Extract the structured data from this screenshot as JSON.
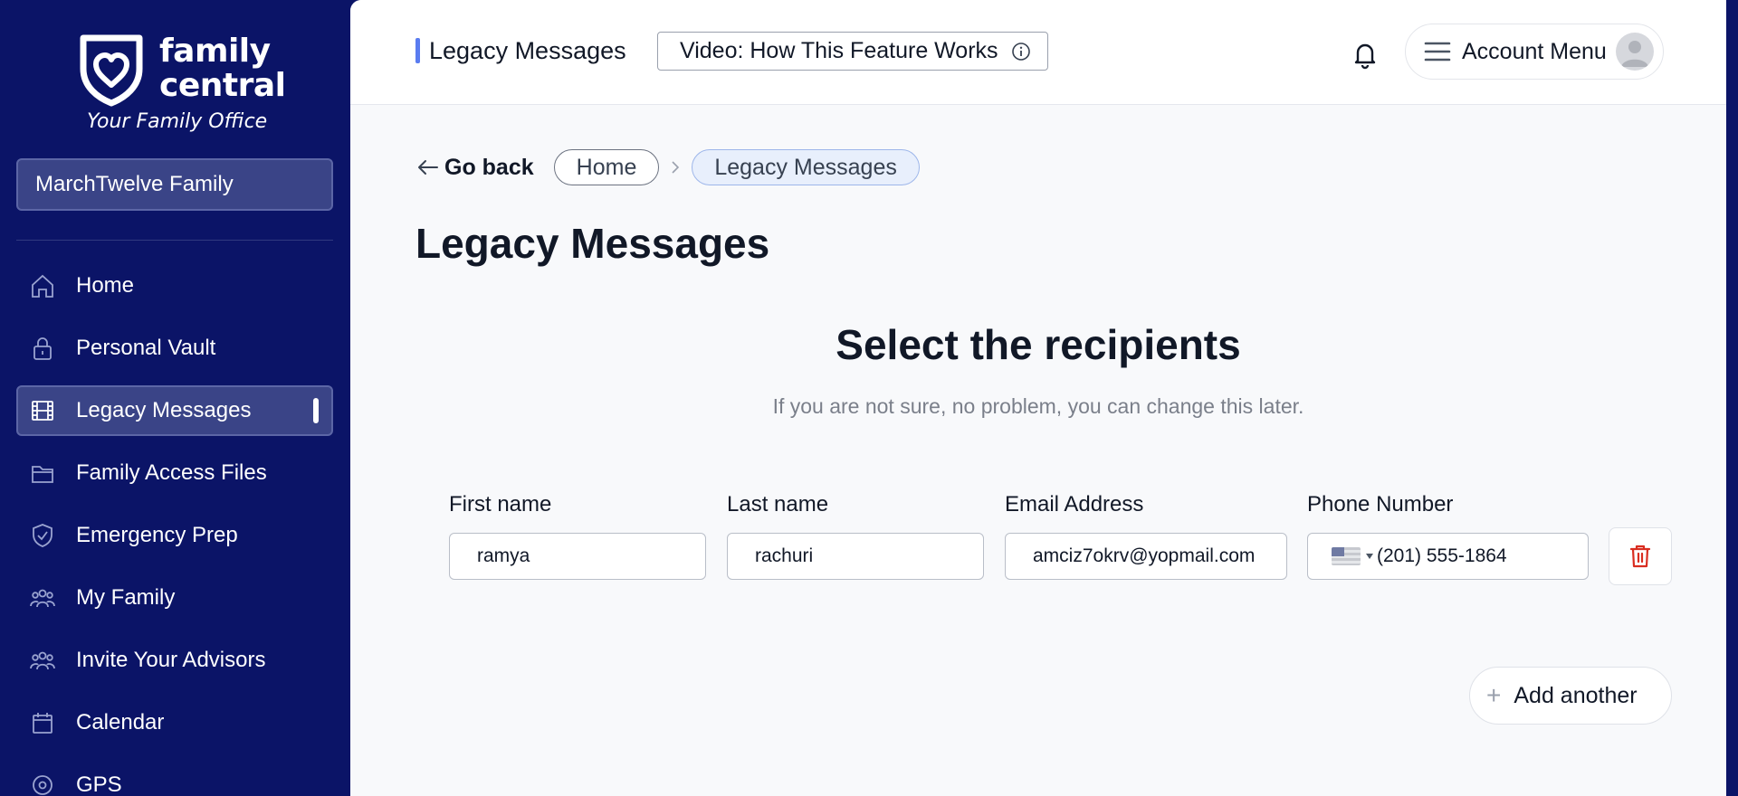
{
  "brand": {
    "name_line1": "family",
    "name_line2": "central",
    "tagline": "Your Family Office",
    "color_navy": "#0b1467",
    "accent_blue": "#5a7cf0",
    "danger_red": "#d92d20"
  },
  "sidebar": {
    "family_selector": "MarchTwelve Family",
    "items": [
      {
        "label": "Home",
        "icon": "home-icon"
      },
      {
        "label": "Personal Vault",
        "icon": "lock-icon"
      },
      {
        "label": "Legacy Messages",
        "icon": "film-icon",
        "active": true
      },
      {
        "label": "Family Access Files",
        "icon": "folder-icon"
      },
      {
        "label": "Emergency Prep",
        "icon": "shield-check-icon"
      },
      {
        "label": "My Family",
        "icon": "people-icon"
      },
      {
        "label": "Invite Your Advisors",
        "icon": "people-icon"
      },
      {
        "label": "Calendar",
        "icon": "calendar-icon"
      },
      {
        "label": "GPS",
        "icon": "location-icon"
      }
    ]
  },
  "topbar": {
    "page_tag": "Legacy Messages",
    "video_button": "Video: How This Feature Works",
    "account_menu": "Account Menu"
  },
  "breadcrumb": {
    "go_back": "Go back",
    "items": [
      "Home",
      "Legacy Messages"
    ]
  },
  "page": {
    "title": "Legacy Messages",
    "section_title": "Select the recipients",
    "section_subtitle": "If you are not sure, no problem, you can change this later."
  },
  "recipient_form": {
    "labels": {
      "first_name": "First name",
      "last_name": "Last name",
      "email": "Email Address",
      "phone": "Phone Number"
    },
    "rows": [
      {
        "first_name": "ramya",
        "last_name": "rachuri",
        "email": "amciz7okrv@yopmail.com",
        "phone_country": "US",
        "phone": "(201) 555-1864"
      }
    ],
    "add_another": "Add another"
  }
}
